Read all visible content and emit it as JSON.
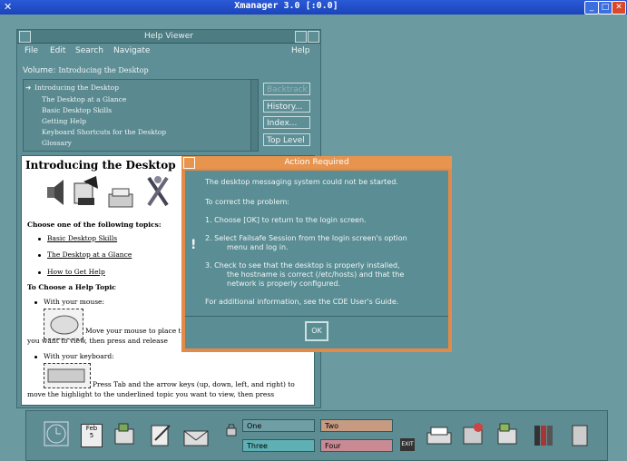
{
  "xmanager": {
    "title": "Xmanager 3.0 [:0.0]"
  },
  "help_viewer": {
    "title": "Help Viewer",
    "menu": [
      "File",
      "Edit",
      "Search",
      "Navigate"
    ],
    "help_menu": "Help",
    "volume_label": "Volume:",
    "volume_value": "Introducing the Desktop",
    "topics": [
      "Introducing the Desktop",
      "The Desktop at a Glance",
      "Basic Desktop Skills",
      "Getting Help",
      "Keyboard Shortcuts for the Desktop",
      "Glossary"
    ],
    "side_buttons": [
      "Backtrack",
      "History...",
      "Index...",
      "Top Level"
    ],
    "content": {
      "heading": "Introducing the Desktop",
      "choose": "Choose one of the following topics:",
      "links": [
        "Basic Desktop Skills",
        "The Desktop at a Glance",
        "How to Get Help"
      ],
      "choose_help": "To Choose a Help Topic",
      "with_mouse": "With your mouse:",
      "mouse_text1": "Move your mouse to place t",
      "mouse_text2": "you want to view, then press and release",
      "with_keyboard": "With your keyboard:",
      "kb_text1": "Press Tab and the arrow keys (up, down, left, and right) to",
      "kb_text2": "move the highlight to the underlined topic you want to view, then press"
    }
  },
  "dialog": {
    "title": "Action Required",
    "line1": "The desktop messaging system could not be started.",
    "line2": "To correct the problem:",
    "step1": "1.  Choose [OK] to return to the login screen.",
    "step2a": "2.  Select Failsafe Session from the login screen's option",
    "step2b": "menu and log in.",
    "step3a": "3.  Check to see that the desktop is properly installed,",
    "step3b": "the hostname is correct (/etc/hosts) and that the",
    "step3c": "network is properly configured.",
    "footer": "For additional information, see the CDE User's Guide.",
    "ok": "OK"
  },
  "panel": {
    "workspaces": [
      "One",
      "Two",
      "Three",
      "Four"
    ],
    "calendar_month": "Feb",
    "calendar_day": "5",
    "exit": "EXIT",
    "colors": {
      "one": "#6f9ea5",
      "two": "#c79a82",
      "three": "#5fb0b4",
      "four": "#c98a94"
    }
  }
}
